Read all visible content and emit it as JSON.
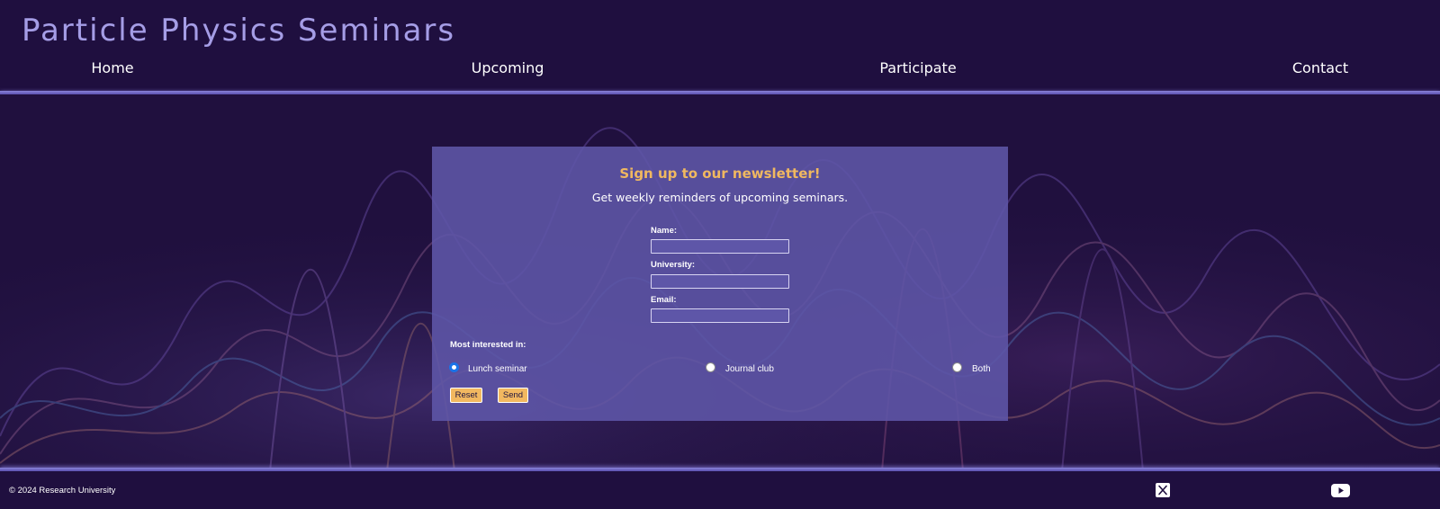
{
  "site": {
    "title": "Particle Physics Seminars"
  },
  "nav": {
    "items": [
      {
        "label": "Home"
      },
      {
        "label": "Upcoming"
      },
      {
        "label": "Participate"
      },
      {
        "label": "Contact"
      }
    ]
  },
  "newsletter": {
    "heading": "Sign up to our newsletter!",
    "subheading": "Get weekly reminders of upcoming seminars.",
    "fields": {
      "name": {
        "label": "Name:",
        "value": ""
      },
      "university": {
        "label": "University:",
        "value": ""
      },
      "email": {
        "label": "Email:",
        "value": ""
      }
    },
    "interest_label": "Most interested in:",
    "options": [
      {
        "label": "Lunch seminar",
        "checked": true
      },
      {
        "label": "Journal club",
        "checked": false
      },
      {
        "label": "Both",
        "checked": false
      }
    ],
    "buttons": {
      "reset": "Reset",
      "send": "Send"
    }
  },
  "footer": {
    "copyright": "© 2024 Research University",
    "social": [
      "x-icon",
      "youtube-icon"
    ]
  },
  "colors": {
    "background": "#1f0f3f",
    "title": "#a59de6",
    "accent": "#f0b860",
    "card": "#5e56a8",
    "radio_selected": "#1a73e8"
  }
}
